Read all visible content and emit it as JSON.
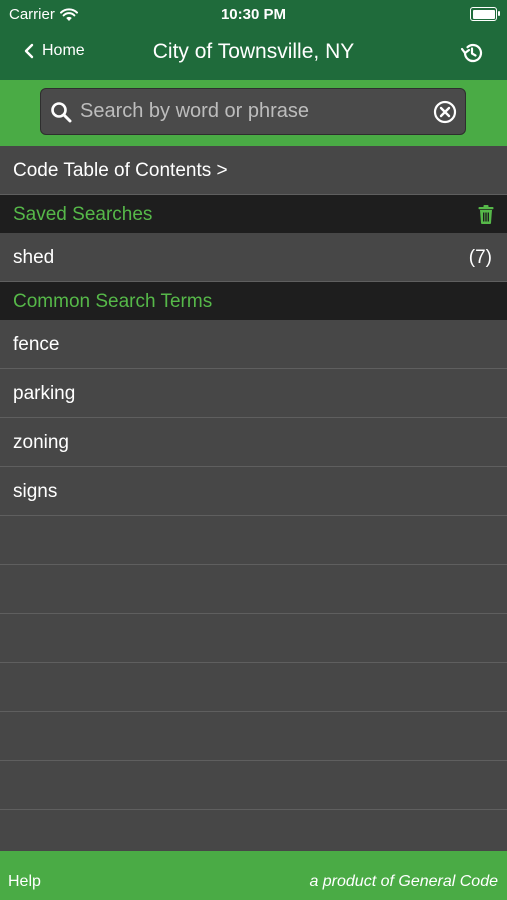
{
  "status_bar": {
    "carrier": "Carrier",
    "time": "10:30 PM"
  },
  "nav": {
    "back_label": "Home",
    "title": "City of Townsville, NY"
  },
  "search": {
    "placeholder": "Search by word or phrase",
    "value": ""
  },
  "toc": {
    "label": "Code Table of Contents >"
  },
  "saved_searches": {
    "header": "Saved Searches",
    "items": [
      {
        "label": "shed",
        "count": "(7)"
      }
    ]
  },
  "common_terms": {
    "header": "Common Search Terms",
    "items": [
      {
        "label": "fence"
      },
      {
        "label": "parking"
      },
      {
        "label": "zoning"
      },
      {
        "label": "signs"
      }
    ]
  },
  "footer": {
    "help": "Help",
    "credit": "a product of General Code"
  },
  "colors": {
    "header_green": "#1f6b3b",
    "accent_green": "#4aab45",
    "section_text": "#56b849",
    "list_bg": "#474747",
    "section_bg": "#1e1e1e"
  },
  "icons": {
    "wifi": "wifi-icon",
    "battery": "battery-icon",
    "back": "chevron-left-icon",
    "history": "history-icon",
    "search": "search-icon",
    "clear": "clear-circle-icon",
    "trash": "trash-icon"
  }
}
